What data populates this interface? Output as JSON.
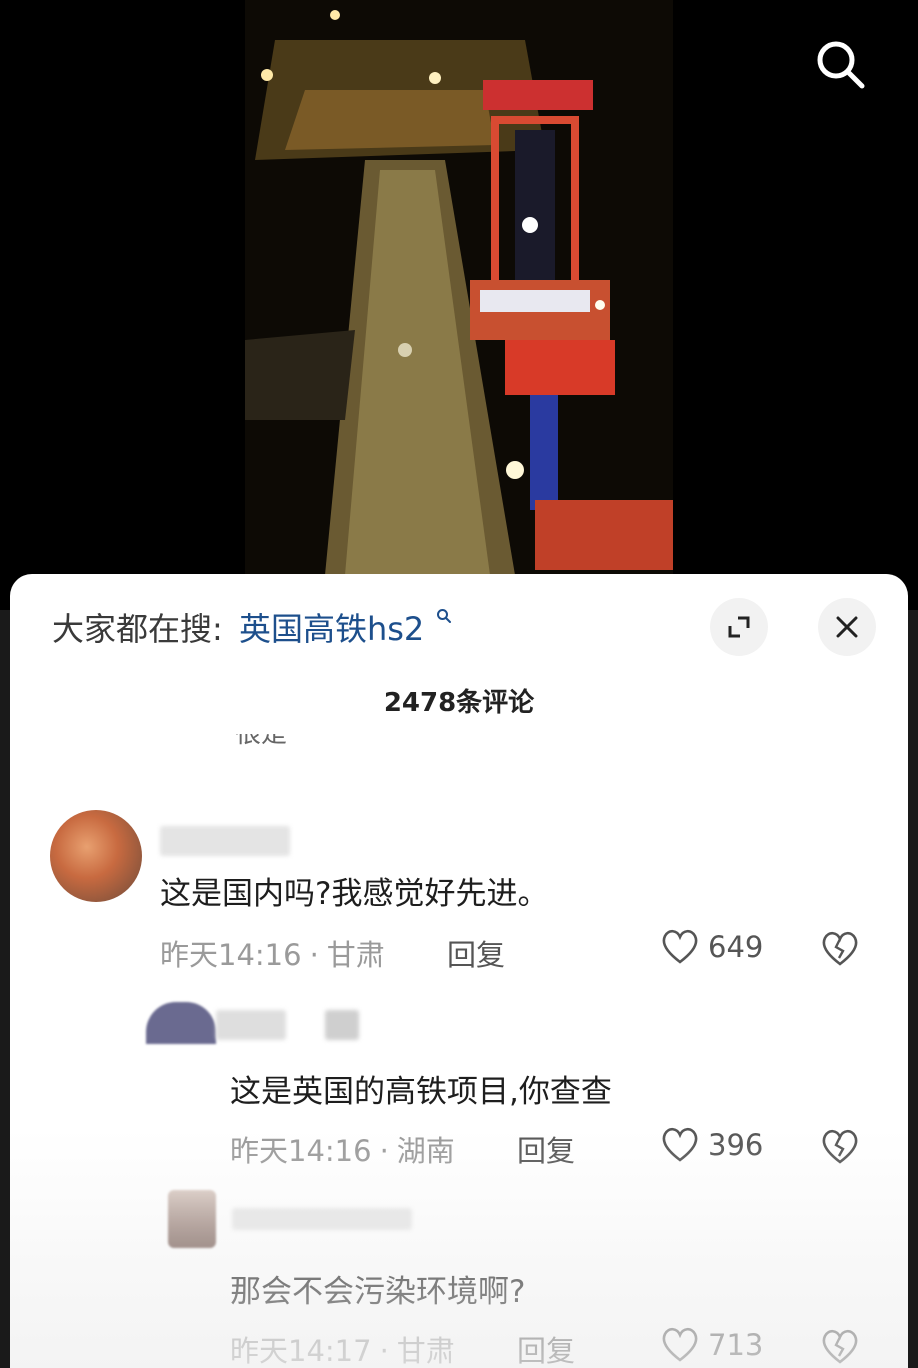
{
  "search_bar": {
    "prefix": "大家都在搜:",
    "term": "英国高铁hs2"
  },
  "comment_count": "2478条评论",
  "clipped_text": "很是",
  "comments": [
    {
      "text": "这是国内吗?我感觉好先进。",
      "time": "昨天14:16",
      "location": "甘肃",
      "reply_label": "回复",
      "likes": "649"
    },
    {
      "text": "这是英国的高铁项目,你查查",
      "time": "昨天14:16",
      "location": "湖南",
      "reply_label": "回复",
      "likes": "396"
    },
    {
      "text": "那会不会污染环境啊?",
      "time": "昨天14:17",
      "location": "甘肃",
      "reply_label": "回复",
      "likes": "713"
    }
  ],
  "colors": {
    "search_term": "#1d4f8c",
    "sheet_bg": "#ffffff",
    "meta_gray": "#9a9a9a"
  },
  "icons": [
    "search-icon",
    "expand-icon",
    "close-icon",
    "heart-icon",
    "broken-heart-icon"
  ]
}
